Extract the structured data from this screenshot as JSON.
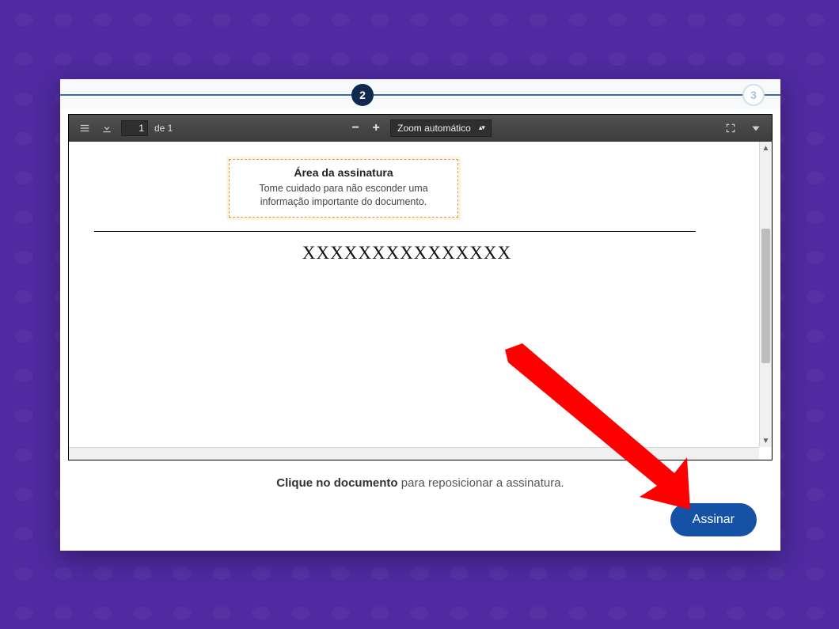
{
  "steps": {
    "current": "2",
    "next": "3"
  },
  "pdf_toolbar": {
    "page_current": "1",
    "page_of": "de 1",
    "zoom_label": "Zoom automático"
  },
  "signature_box": {
    "title": "Área da assinatura",
    "description": "Tome cuidado para não esconder uma informação importante do documento."
  },
  "document": {
    "placeholder_name": "XXXXXXXXXXXXXXX"
  },
  "footer": {
    "help_bold": "Clique no documento",
    "help_rest": " para reposicionar a assinatura.",
    "sign_label": "Assinar"
  }
}
